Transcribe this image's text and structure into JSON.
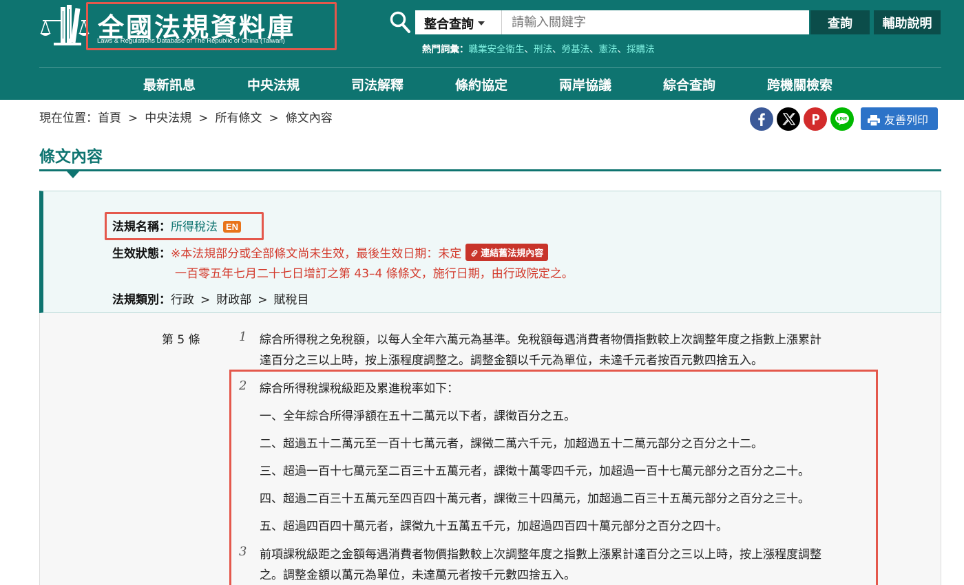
{
  "header": {
    "logo_title": "全國法規資料庫",
    "logo_subtitle": "Laws & Regulations Database of The Republic of China (Taiwan)",
    "search": {
      "scope_label": "整合查詢",
      "placeholder": "請輸入關鍵字",
      "submit_label": "查詢",
      "help_label": "輔助說明"
    },
    "hot_terms": {
      "label": "熱門詞彙：",
      "separator": "、",
      "terms": [
        "職業安全衛生",
        "刑法",
        "勞基法",
        "憲法",
        "採購法"
      ]
    },
    "nav": [
      "最新訊息",
      "中央法規",
      "司法解釋",
      "條約協定",
      "兩岸協議",
      "綜合查詢",
      "跨機關檢索"
    ]
  },
  "breadcrumb": {
    "prefix": "現在位置：",
    "items": [
      "首頁",
      "中央法規",
      "所有條文",
      "條文內容"
    ],
    "separator": ">"
  },
  "share": {
    "buttons": [
      "facebook",
      "x",
      "plurk",
      "line"
    ],
    "print_label": "友善列印",
    "colors": {
      "facebook": "#3b5998",
      "x": "#000000",
      "plurk": "#d22b2b",
      "line": "#00b900"
    }
  },
  "section_title": "條文內容",
  "law_info": {
    "name_label": "法規名稱：",
    "name": "所得稅法",
    "en_badge": "EN",
    "status_label": "生效狀態：",
    "status_text": "※本法規部分或全部條文尚未生效，最後生效日期：未定",
    "old_link_label": "連結舊法規內容",
    "status_note": "一百零五年七月二十七日增訂之第 43–4 條條文，施行日期，由行政院定之。",
    "category_label": "法規類別：",
    "category": [
      "行政",
      "財政部",
      "賦稅目"
    ],
    "category_separator": ">"
  },
  "article": {
    "number_label": "第 5 條",
    "paragraphs": [
      {
        "num": "1",
        "lines": [
          "綜合所得稅之免稅額，以每人全年六萬元為基準。免稅額每遇消費者物價指數較上次調整年度之指數上漲累計",
          "達百分之三以上時，按上漲程度調整之。調整金額以千元為單位，未達千元者按百元數四捨五入。"
        ]
      },
      {
        "num": "2",
        "lines": [
          "綜合所得稅課稅級距及累進稅率如下：",
          "一、全年綜合所得淨額在五十二萬元以下者，課徵百分之五。",
          "二、超過五十二萬元至一百十七萬元者，課徵二萬六千元，加超過五十二萬元部分之百分之十二。",
          "三、超過一百十七萬元至二百三十五萬元者，課徵十萬零四千元，加超過一百十七萬元部分之百分之二十。",
          "四、超過二百三十五萬元至四百四十萬元者，課徵三十四萬元，加超過二百三十五萬元部分之百分之三十。",
          "五、超過四百四十萬元者，課徵九十五萬五千元，加超過四百四十萬元部分之百分之四十。"
        ]
      },
      {
        "num": "3",
        "lines": [
          "前項課稅級距之金額每遇消費者物價指數較上次調整年度之指數上漲累計達百分之三以上時，按上漲程度調整",
          "之。調整金額以萬元為單位，未達萬元者按千元數四捨五入。"
        ]
      }
    ]
  },
  "colors": {
    "brand": "#0e7470",
    "brand_dark": "#0b4d4a",
    "hot_term": "#7ef0e0",
    "status_red": "#d33a2c",
    "annotation": "#e4584c"
  }
}
